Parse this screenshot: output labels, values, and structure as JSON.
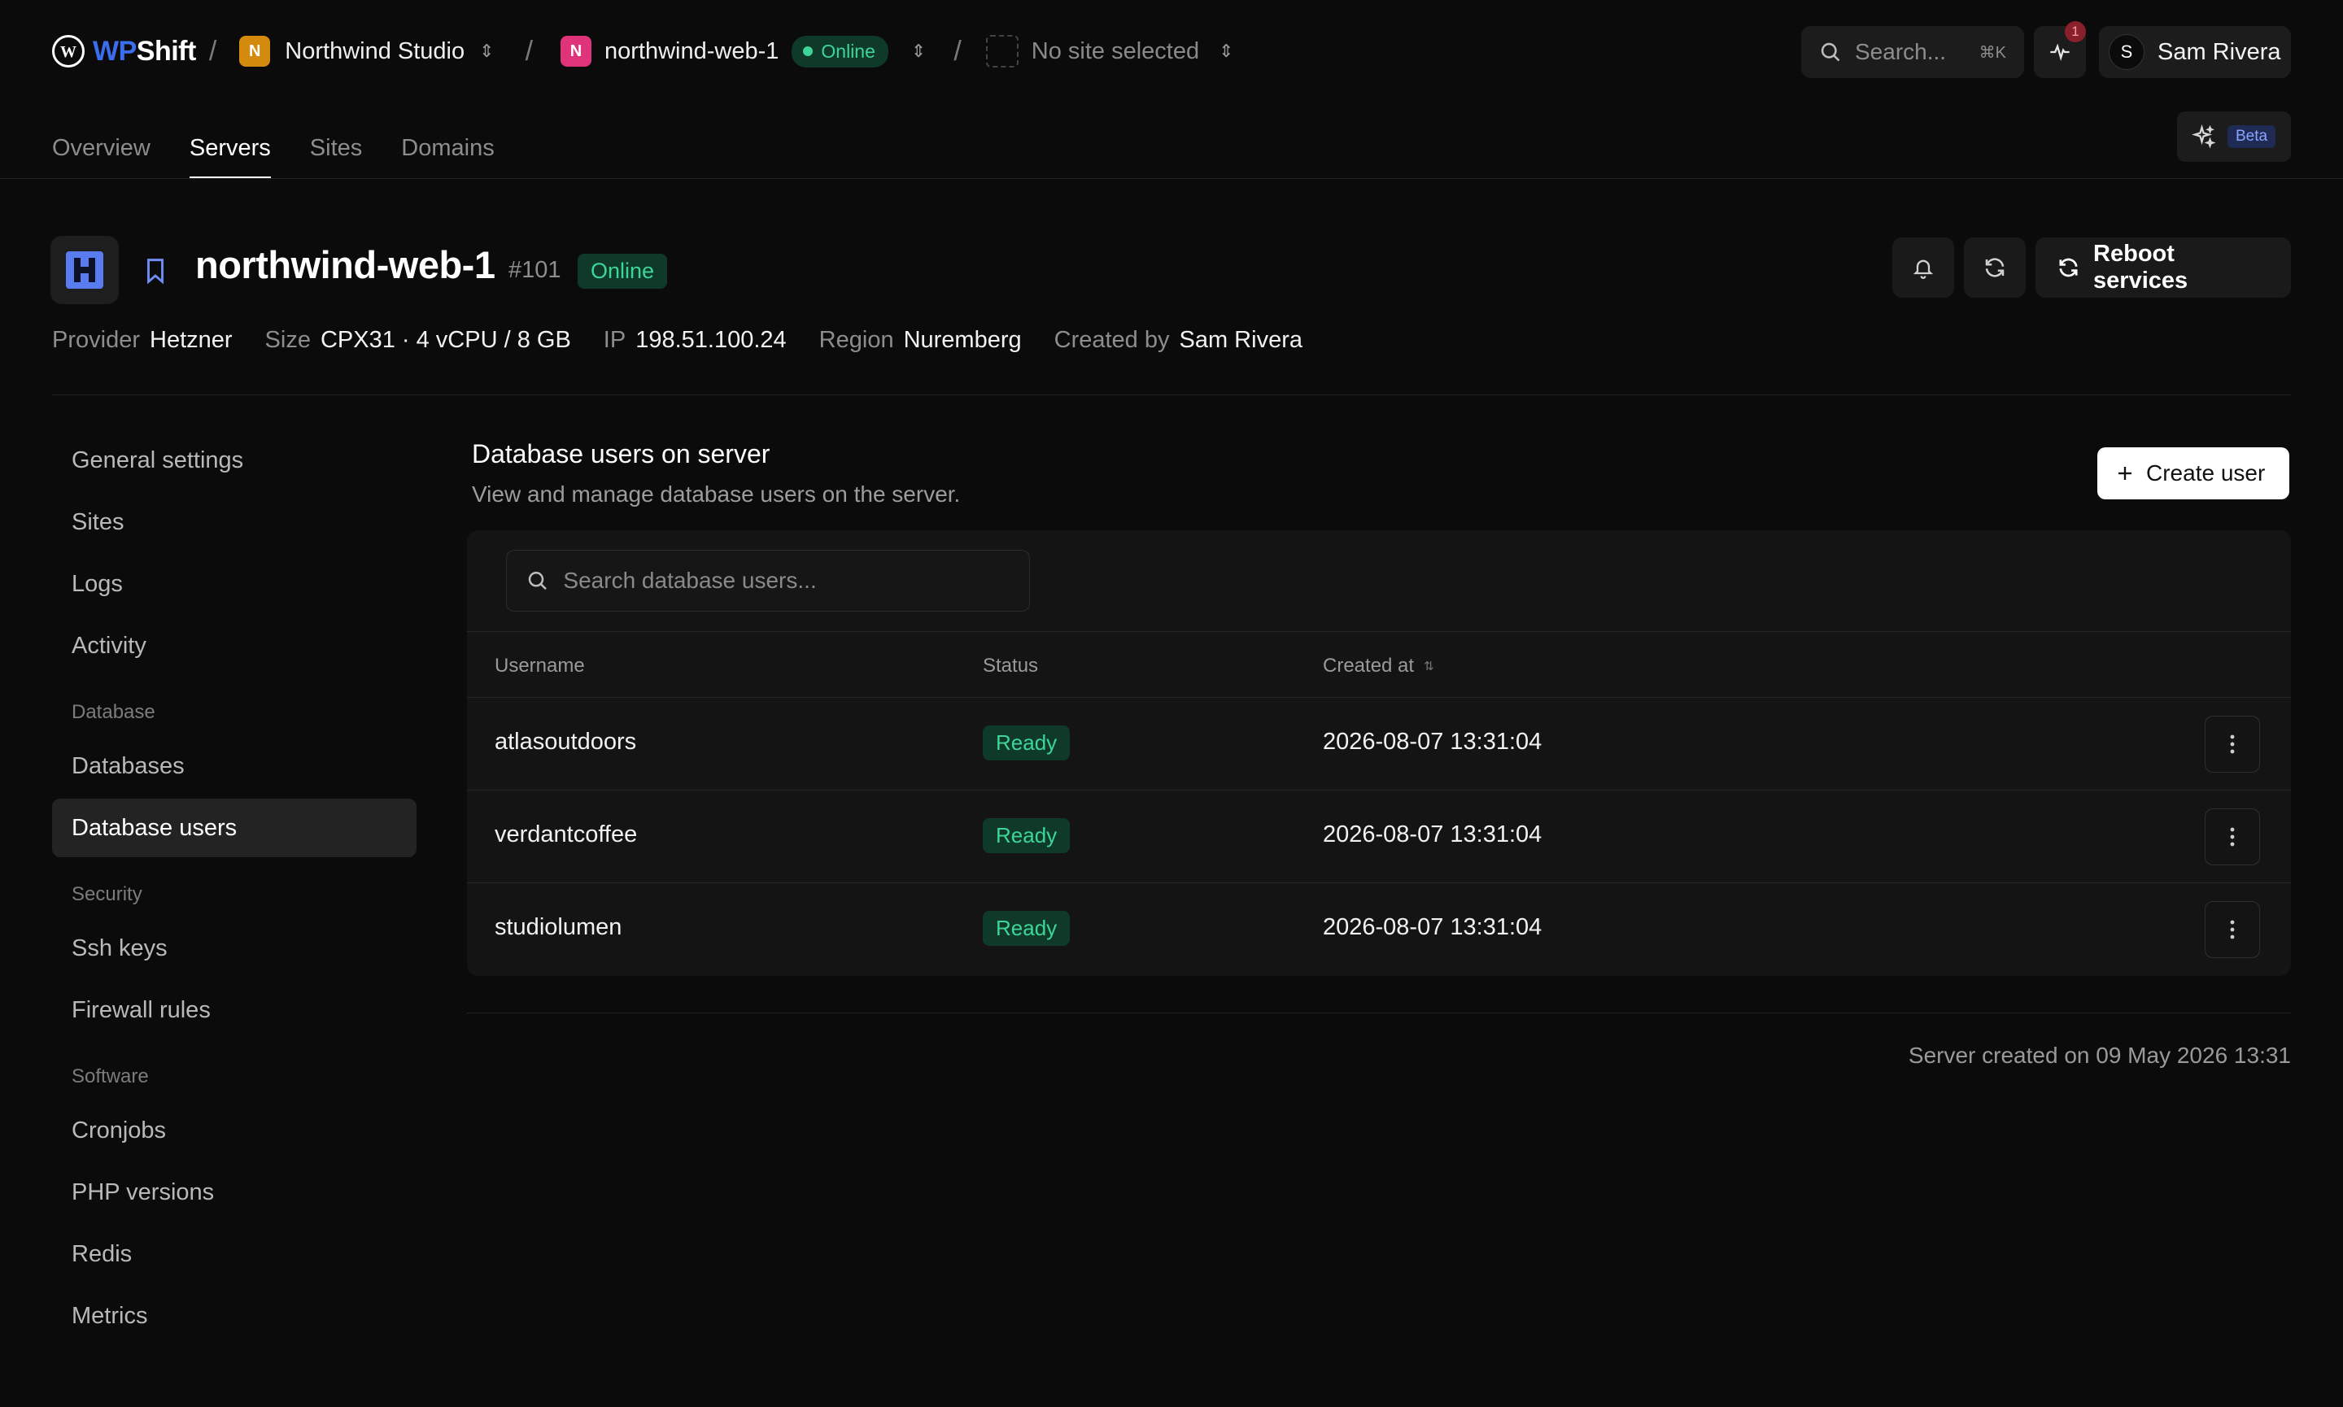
{
  "header": {
    "brand_wp": "WP",
    "brand_shift": "Shift",
    "org_initial": "N",
    "org_name": "Northwind Studio",
    "server_initial": "N",
    "server_name": "northwind-web-1",
    "server_status": "Online",
    "site_placeholder": "No site selected",
    "search_placeholder": "Search...",
    "search_shortcut": "⌘K",
    "notification_count": "1",
    "user_initial": "S",
    "user_name": "Sam Rivera",
    "beta_label": "Beta"
  },
  "nav_tabs": [
    {
      "label": "Overview",
      "active": false
    },
    {
      "label": "Servers",
      "active": true
    },
    {
      "label": "Sites",
      "active": false
    },
    {
      "label": "Domains",
      "active": false
    }
  ],
  "server": {
    "name": "northwind-web-1",
    "id": "#101",
    "status": "Online",
    "reboot_label": "Reboot services",
    "meta": [
      {
        "key": "Provider",
        "value": "Hetzner"
      },
      {
        "key": "Size",
        "value": "CPX31 · 4 vCPU / 8 GB"
      },
      {
        "key": "IP",
        "value": "198.51.100.24"
      },
      {
        "key": "Region",
        "value": "Nuremberg"
      },
      {
        "key": "Created by",
        "value": "Sam Rivera"
      }
    ]
  },
  "sidebar": {
    "items_top": [
      "General settings",
      "Sites",
      "Logs",
      "Activity"
    ],
    "group_database": "Database",
    "items_database": [
      "Databases",
      "Database users"
    ],
    "active_item": "Database users",
    "group_security": "Security",
    "items_security": [
      "Ssh keys",
      "Firewall rules"
    ],
    "group_software": "Software",
    "items_software": [
      "Cronjobs",
      "PHP versions",
      "Redis",
      "Metrics"
    ]
  },
  "content": {
    "title": "Database users on server",
    "subtitle": "View and manage database users on the server.",
    "create_label": "Create user",
    "search_placeholder": "Search database users...",
    "columns": {
      "username": "Username",
      "status": "Status",
      "created_at": "Created at"
    },
    "rows": [
      {
        "username": "atlasoutdoors",
        "status": "Ready",
        "created_at": "2026-08-07 13:31:04"
      },
      {
        "username": "verdantcoffee",
        "status": "Ready",
        "created_at": "2026-08-07 13:31:04"
      },
      {
        "username": "studiolumen",
        "status": "Ready",
        "created_at": "2026-08-07 13:31:04"
      }
    ],
    "footer": "Server created on 09 May 2026 13:31"
  },
  "colors": {
    "background": "#0b0b0b",
    "accent_green": "#3ed598",
    "brand_blue": "#3b6df0",
    "org_badge": "#d48a0c",
    "server_badge": "#e0347a"
  }
}
